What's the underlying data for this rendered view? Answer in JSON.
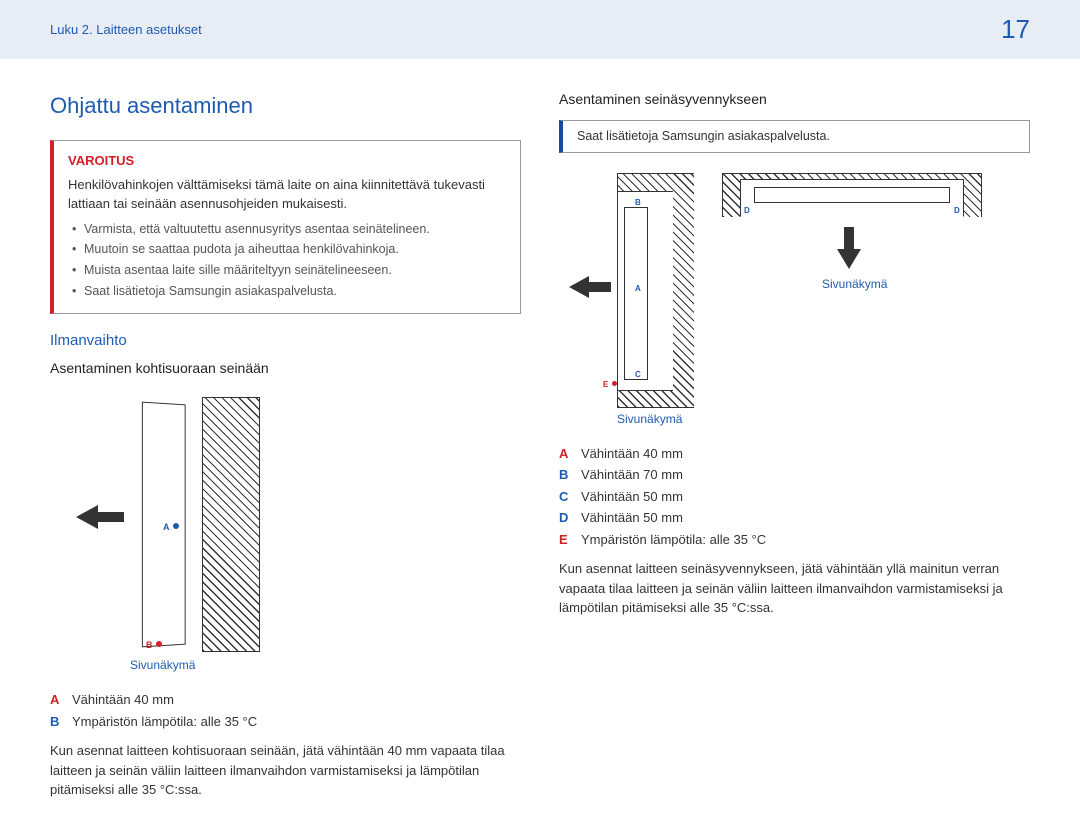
{
  "header": {
    "breadcrumb": "Luku 2. Laitteen asetukset",
    "page_number": "17"
  },
  "left": {
    "h1": "Ohjattu asentaminen",
    "warning": {
      "title": "VAROITUS",
      "intro": "Henkilövahinkojen välttämiseksi tämä laite on aina kiinnitettävä tukevasti lattiaan tai seinään asennusohjeiden mukaisesti.",
      "bullets": [
        "Varmista, että valtuutettu asennusyritys asentaa seinätelineen.",
        "Muutoin se saattaa pudota ja aiheuttaa henkilövahinkoja.",
        "Muista asentaa laite sille määriteltyyn seinätelineeseen.",
        "Saat lisätietoja Samsungin asiakaspalvelusta."
      ]
    },
    "h2": "Ilmanvaihto",
    "h3": "Asentaminen kohtisuoraan seinään",
    "figure1": {
      "caption": "Sivunäkymä",
      "marker_a": "A",
      "marker_b": "B"
    },
    "legend": [
      {
        "key": "A",
        "cls": "k-a",
        "text": "Vähintään 40 mm"
      },
      {
        "key": "B",
        "cls": "k-b",
        "text": "Ympäristön lämpötila: alle 35 °C"
      }
    ],
    "body": "Kun asennat laitteen kohtisuoraan seinään, jätä vähintään 40 mm vapaata tilaa laitteen ja seinän väliin laitteen ilmanvaihdon varmistamiseksi ja lämpötilan pitämiseksi alle 35 °C:ssa."
  },
  "right": {
    "h3": "Asentaminen seinäsyvennykseen",
    "info": "Saat lisätietoja Samsungin asiakaspalvelusta.",
    "figure2": {
      "caption_side": "Sivunäkymä",
      "caption_top": "Sivunäkymä",
      "m_a": "A",
      "m_b": "B",
      "m_c": "C",
      "m_d": "D",
      "m_e": "E"
    },
    "legend": [
      {
        "key": "A",
        "cls": "k-a",
        "text": "Vähintään 40 mm"
      },
      {
        "key": "B",
        "cls": "k-b",
        "text": "Vähintään 70 mm"
      },
      {
        "key": "C",
        "cls": "k-c",
        "text": "Vähintään 50 mm"
      },
      {
        "key": "D",
        "cls": "k-d",
        "text": "Vähintään 50 mm"
      },
      {
        "key": "E",
        "cls": "k-e",
        "text": "Ympäristön lämpötila: alle 35 °C"
      }
    ],
    "body": "Kun asennat laitteen seinäsyvennykseen, jätä vähintään yllä mainitun verran vapaata tilaa laitteen ja seinän väliin laitteen ilmanvaihdon varmistamiseksi ja lämpötilan pitämiseksi alle 35 °C:ssa."
  }
}
